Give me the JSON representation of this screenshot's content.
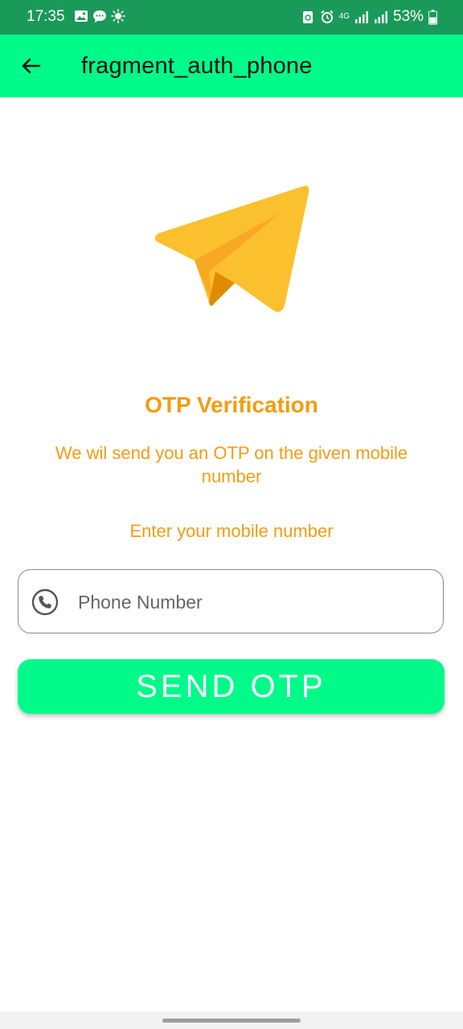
{
  "status_bar": {
    "time": "17:35",
    "network": "4G",
    "battery": "53%",
    "left_icons": [
      "image-icon",
      "chat-icon",
      "brightness-icon"
    ],
    "right_icons": [
      "recycle-icon",
      "alarm-icon",
      "signal-icon",
      "battery-icon"
    ]
  },
  "app_bar": {
    "title": "fragment_auth_phone",
    "background": "#00fa8a"
  },
  "content": {
    "headline": "OTP Verification",
    "subtitle": "We wil send you an OTP on the given mobile number",
    "prompt": "Enter your mobile number",
    "accent_color": "#f39c12"
  },
  "phone_field": {
    "placeholder": "Phone Number",
    "value": ""
  },
  "send_button": {
    "label": "SEND OTP"
  }
}
